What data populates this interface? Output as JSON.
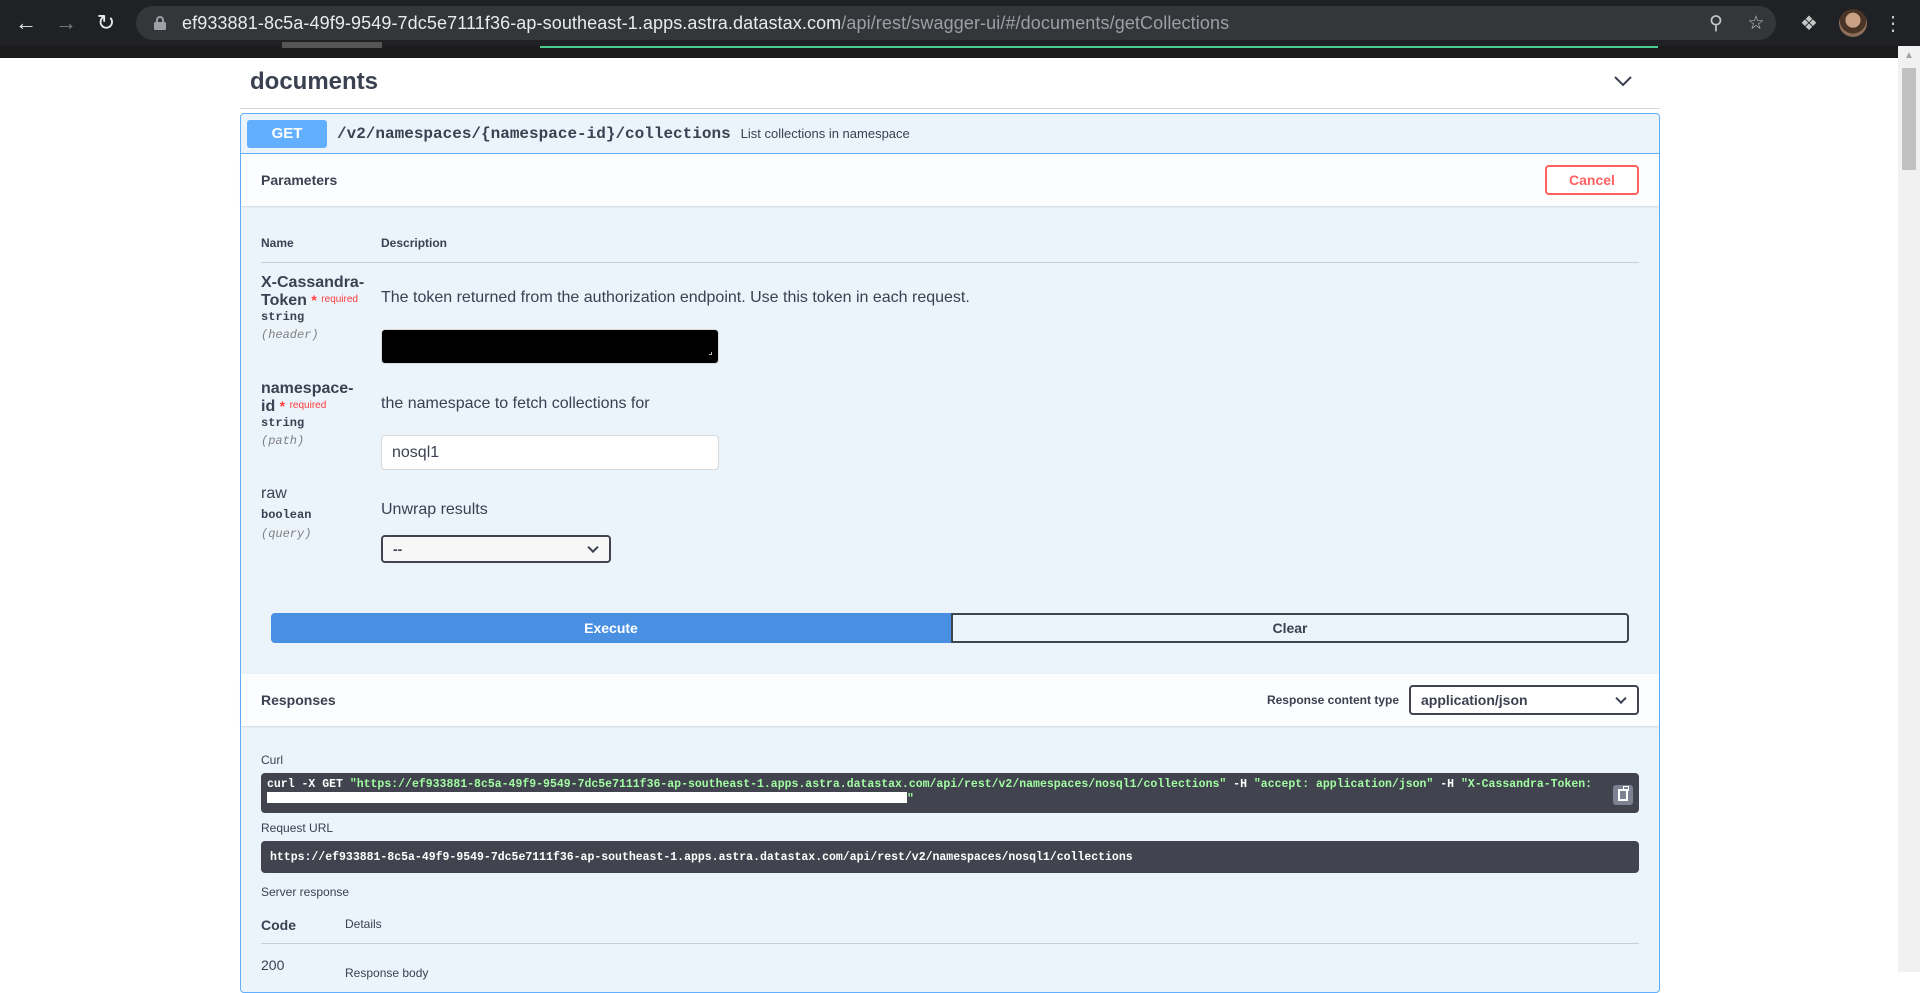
{
  "browser": {
    "url_host": "ef933881-8c5a-49f9-9549-7dc5e7111f36-ap-southeast-1.apps.astra.datastax.com",
    "url_path": "/api/rest/swagger-ui/#/documents/getCollections"
  },
  "tag": {
    "title": "documents"
  },
  "operation": {
    "method": "GET",
    "path": "/v2/namespaces/{namespace-id}/collections",
    "description": "List collections in namespace"
  },
  "parameters": {
    "title": "Parameters",
    "cancel_label": "Cancel",
    "col_name": "Name",
    "col_description": "Description",
    "required_label": "required",
    "items": [
      {
        "name_line1": "X-Cassandra-",
        "name_line2": "Token",
        "type": "string",
        "in": "(header)",
        "description": "The token returned from the authorization endpoint. Use this token in each request."
      },
      {
        "name_line1": "namespace-",
        "name_line2": "id",
        "type": "string",
        "in": "(path)",
        "description": "the namespace to fetch collections for",
        "value": "nosql1"
      },
      {
        "name": "raw",
        "type": "boolean",
        "in": "(query)",
        "description": "Unwrap results",
        "selected": "--"
      }
    ]
  },
  "actions": {
    "execute_label": "Execute",
    "clear_label": "Clear"
  },
  "responses": {
    "title": "Responses",
    "content_type_label": "Response content type",
    "content_type_value": "application/json",
    "curl_label": "Curl",
    "curl_prefix": "curl -X GET ",
    "curl_url": "\"https://ef933881-8c5a-49f9-9549-7dc5e7111f36-ap-southeast-1.apps.astra.datastax.com/api/rest/v2/namespaces/nosql1/collections\"",
    "curl_h1": " -H  ",
    "curl_accept": "\"accept: application/json\"",
    "curl_h2": " -H  ",
    "curl_token": "\"X-Cassandra-Token:",
    "curl_tail": "\"",
    "request_url_label": "Request URL",
    "request_url": "https://ef933881-8c5a-49f9-9549-7dc5e7111f36-ap-southeast-1.apps.astra.datastax.com/api/rest/v2/namespaces/nosql1/collections",
    "server_response_label": "Server response",
    "code_header": "Code",
    "details_header": "Details",
    "code_value": "200",
    "response_body_label": "Response body"
  }
}
